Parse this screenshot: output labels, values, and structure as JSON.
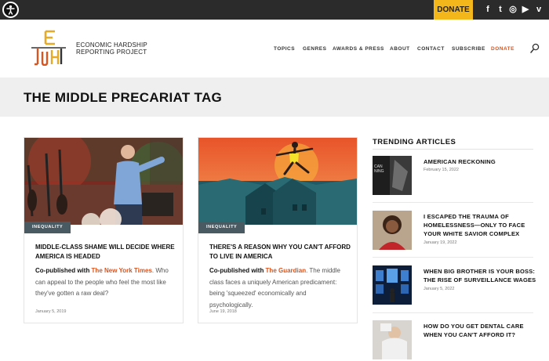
{
  "topbar": {
    "donate_label": "DONATE",
    "social": [
      {
        "name": "facebook-icon",
        "glyph": "f"
      },
      {
        "name": "twitter-icon",
        "glyph": "t"
      },
      {
        "name": "instagram-icon",
        "glyph": "◎"
      },
      {
        "name": "youtube-icon",
        "glyph": "▶"
      },
      {
        "name": "vimeo-icon",
        "glyph": "v"
      }
    ]
  },
  "header": {
    "logo_line1": "ECONOMIC HARDSHIP",
    "logo_line2": "REPORTING PROJECT",
    "nav": [
      "TOPICS",
      "GENRES",
      "AWARDS & PRESS",
      "ABOUT",
      "CONTACT",
      "SUBSCRIBE",
      "DONATE"
    ]
  },
  "page": {
    "title": "THE MIDDLE PRECARIAT TAG"
  },
  "cards": [
    {
      "tag": "INEQUALITY",
      "title": "MIDDLE-CLASS SHAME WILL DECIDE WHERE AMERICA IS HEADED",
      "copub": "Co-published with ",
      "outlet": "The New York Times",
      "desc": ". Who can appeal to the people who feel the most like they've gotten a raw deal?",
      "date": "January 5, 2019"
    },
    {
      "tag": "INEQUALITY",
      "title": "THERE'S A REASON WHY YOU CAN'T AFFORD TO LIVE IN AMERICA",
      "copub": "Co-published with ",
      "outlet": "The Guardian",
      "desc": ". The middle class faces a uniquely American predicament: being 'squeezed' economically and psychologically.",
      "date": "June 19, 2018"
    }
  ],
  "trending": {
    "heading": "TRENDING ARTICLES",
    "items": [
      {
        "title": "AMERICAN RECKONING",
        "date": "February 15, 2022"
      },
      {
        "title": "I ESCAPED THE TRAUMA OF HOMELESSNESS—ONLY TO FACE YOUR WHITE SAVIOR COMPLEX",
        "date": "January 19, 2022"
      },
      {
        "title": "WHEN BIG BROTHER IS YOUR BOSS: THE RISE OF SURVEILLANCE WAGES",
        "date": "January 5, 2022"
      },
      {
        "title": "HOW DO YOU GET DENTAL CARE WHEN YOU CAN'T AFFORD IT?",
        "date": ""
      }
    ]
  },
  "colors": {
    "accent": "#d9541e",
    "donate_bg": "#f3b71b",
    "tag_bg": "#4a5a63",
    "topbar_bg": "#2b2b2b"
  }
}
